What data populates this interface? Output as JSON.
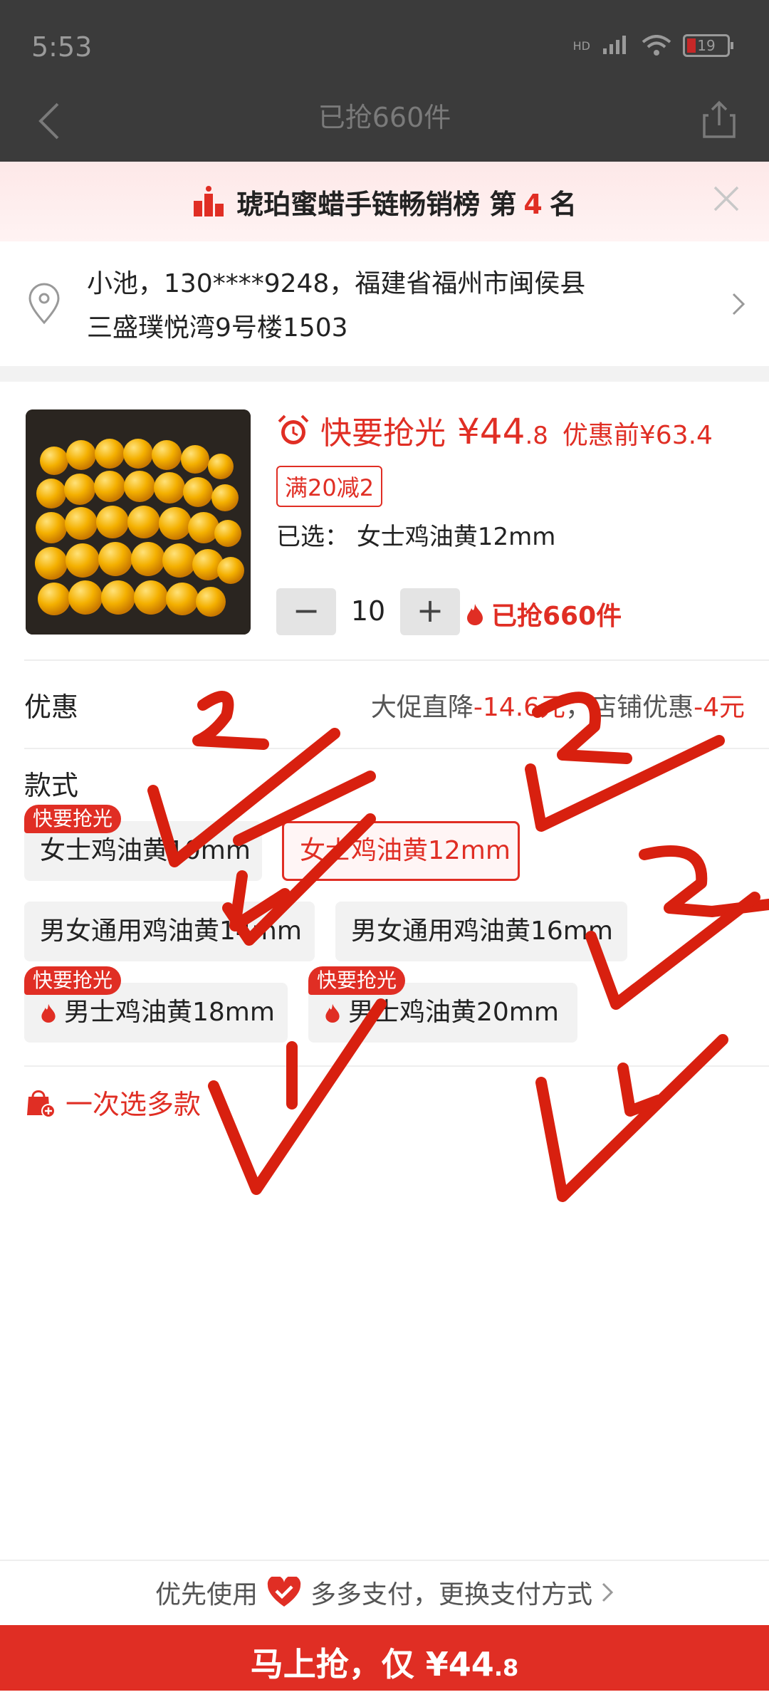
{
  "status": {
    "time": "5:53",
    "network": "HD",
    "battery": "19"
  },
  "nav": {
    "title": "已抢660件"
  },
  "banner": {
    "prefix": "琥珀蜜蜡手链畅销榜 第",
    "rank": "4",
    "suffix": "名"
  },
  "address": {
    "line1": "小池，130****9248，福建省福州市闽侯县",
    "line2": "三盛璞悦湾9号楼1503"
  },
  "product": {
    "sell_fast": "快要抢光",
    "price_main": "¥44",
    "price_decimal": ".8",
    "price_before": "优惠前¥63.4",
    "coupon": "满20减2",
    "selected_label": "已选：",
    "selected_value": "女士鸡油黄12mm",
    "qty_minus": "−",
    "quantity": "10",
    "qty_plus": "+",
    "sold": "已抢660件"
  },
  "promo": {
    "label": "优惠",
    "part1": "大促直降",
    "amount1": "-14.6元",
    "sep": "，",
    "part2": "店铺优惠",
    "amount2": "-4元"
  },
  "style": {
    "label": "款式",
    "options": [
      {
        "label": "女士鸡油黄10mm",
        "tag": "快要抢光",
        "active": false,
        "hot": false
      },
      {
        "label": "女士鸡油黄12mm",
        "tag": "",
        "active": true,
        "hot": false
      },
      {
        "label": "男女通用鸡油黄14mm",
        "tag": "",
        "active": false,
        "hot": false
      },
      {
        "label": "男女通用鸡油黄16mm",
        "tag": "",
        "active": false,
        "hot": false
      },
      {
        "label": "男士鸡油黄18mm",
        "tag": "快要抢光",
        "active": false,
        "hot": true
      },
      {
        "label": "男士鸡油黄20mm",
        "tag": "快要抢光",
        "active": false,
        "hot": true
      }
    ],
    "multi": "一次选多款"
  },
  "payment": {
    "prefix": "优先使用",
    "method": "多多支付，更换支付方式"
  },
  "buy": {
    "label": "马上抢，仅 ¥44",
    "decimal": ".8"
  },
  "colors": {
    "accent": "#e02e24",
    "scribble": "#d8200f"
  }
}
